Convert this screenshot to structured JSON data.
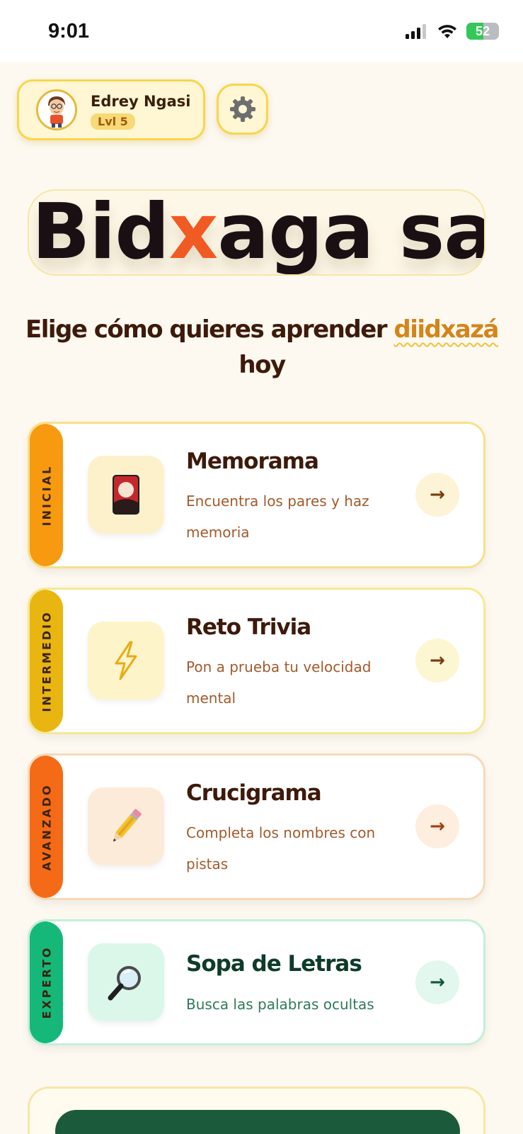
{
  "status_bar": {
    "time": "9:01",
    "battery_percent": "52",
    "battery_level": 0.52
  },
  "profile": {
    "name": "Edrey Ngasi",
    "level": "Lvl 5"
  },
  "settings": {
    "icon": "gear-icon"
  },
  "logo": {
    "part1": "Bid",
    "part2": "x",
    "part3": "aga saa"
  },
  "headline": {
    "text_before": "Elige cómo quieres aprender ",
    "highlight": "diidxazá",
    "text_after": "hoy"
  },
  "games": [
    {
      "level": "INICIAL",
      "title": "Memorama",
      "desc_line1": "Encuentra los pares y haz",
      "desc_line2": "memoria",
      "icon": "card-icon",
      "arrow": "→",
      "colors": {
        "strip": "#f79a10",
        "border": "#f7e08a",
        "icon_bg": "#fdf1cc",
        "title": "#3d1a0a",
        "desc": "#a35a2c",
        "arrow_bg": "#fdf3d6",
        "arrow": "#7a3a10"
      }
    },
    {
      "level": "INTERMEDIO",
      "title": "Reto Trivia",
      "desc_line1": "Pon a prueba tu velocidad",
      "desc_line2": "mental",
      "icon": "lightning-icon",
      "arrow": "→",
      "colors": {
        "strip": "#e9b510",
        "border": "#f7e890",
        "icon_bg": "#fdf5c9",
        "title": "#3d1a0a",
        "desc": "#a35a2c",
        "arrow_bg": "#fdf6d2",
        "arrow": "#7a3a10"
      }
    },
    {
      "level": "AVANZADO",
      "title": "Crucigrama",
      "desc_line1": "Completa los nombres con",
      "desc_line2": "pistas",
      "icon": "pencil-icon",
      "arrow": "→",
      "colors": {
        "strip": "#f56a16",
        "border": "#f8d9b8",
        "icon_bg": "#fdebd9",
        "title": "#3d1a0a",
        "desc": "#a35a2c",
        "arrow_bg": "#fdeee0",
        "arrow": "#a3400f"
      }
    },
    {
      "level": "EXPERTO",
      "title": "Sopa de Letras",
      "desc_line1": "Busca las palabras ocultas",
      "desc_line2": "",
      "icon": "magnifier-icon",
      "arrow": "→",
      "colors": {
        "strip": "#15b879",
        "border": "#c3efd8",
        "icon_bg": "#dbf7ea",
        "title": "#0e3b2a",
        "desc": "#2f7a5a",
        "arrow_bg": "#e2f7ed",
        "arrow": "#16573c"
      }
    }
  ]
}
